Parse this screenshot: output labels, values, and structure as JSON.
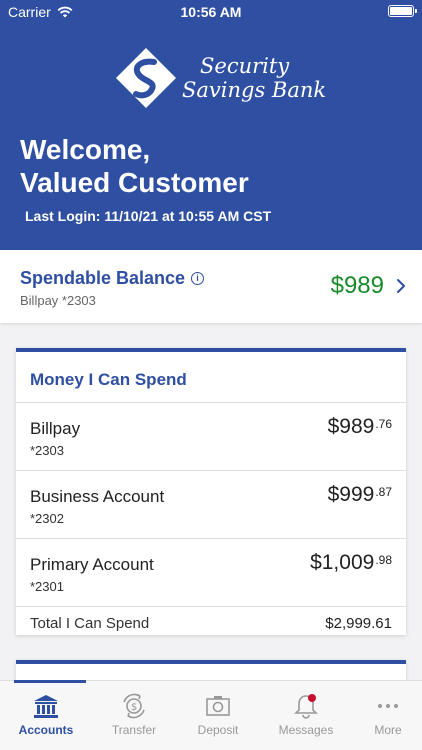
{
  "status_bar": {
    "carrier": "Carrier",
    "time": "10:56 AM"
  },
  "header": {
    "logo_line1": "Security",
    "logo_line2": "Savings Bank",
    "welcome_line1": "Welcome,",
    "welcome_line2": "Valued Customer",
    "last_login": "Last Login: 11/10/21 at 10:55 AM CST"
  },
  "spendable": {
    "title": "Spendable Balance",
    "info_glyph": "i",
    "account": "Billpay *2303",
    "amount": "$989"
  },
  "money_card": {
    "title": "Money I Can Spend",
    "accounts": [
      {
        "name": "Billpay",
        "number": "*2303",
        "dollars": "$989",
        "cents": ".76"
      },
      {
        "name": "Business Account",
        "number": "*2302",
        "dollars": "$999",
        "cents": ".87"
      },
      {
        "name": "Primary Account",
        "number": "*2301",
        "dollars": "$1,009",
        "cents": ".98"
      }
    ],
    "total_label": "Total I Can Spend",
    "total_value": "$2,999.61"
  },
  "tabs": [
    {
      "label": "Accounts",
      "icon": "bank-icon",
      "active": true
    },
    {
      "label": "Transfer",
      "icon": "transfer-icon",
      "active": false
    },
    {
      "label": "Deposit",
      "icon": "camera-icon",
      "active": false
    },
    {
      "label": "Messages",
      "icon": "bell-icon",
      "active": false
    },
    {
      "label": "More",
      "icon": "more-icon",
      "active": false
    }
  ],
  "colors": {
    "brand_blue": "#2f4fa2",
    "balance_green": "#1a8a2a",
    "notification_red": "#c8102e",
    "inactive_gray": "#999999"
  }
}
